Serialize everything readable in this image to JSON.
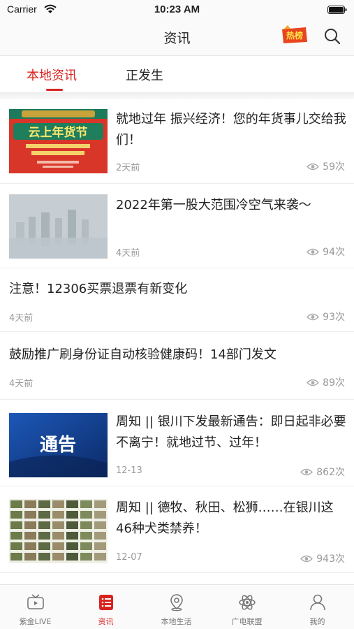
{
  "status_bar": {
    "carrier": "Carrier",
    "time": "10:23 AM"
  },
  "nav": {
    "title": "资讯",
    "hot_badge_text": "热榜"
  },
  "tabs": [
    {
      "label": "本地资讯"
    },
    {
      "label": "正发生"
    }
  ],
  "feed": [
    {
      "title": "就地过年 振兴经济！您的年货事儿交给我们！",
      "time": "2天前",
      "views": "59次",
      "thumb_text": "云上年货节"
    },
    {
      "title": "2022年第一股大范围冷空气来袭～",
      "time": "4天前",
      "views": "94次"
    },
    {
      "title": "注意！12306买票退票有新变化",
      "time": "4天前",
      "views": "93次"
    },
    {
      "title": "鼓励推广刷身份证自动核验健康码！14部门发文",
      "time": "4天前",
      "views": "89次"
    },
    {
      "title": "周知 || 银川下发最新通告：即日起非必要不离宁！就地过节、过年！",
      "time": "12-13",
      "views": "862次",
      "thumb_text": "通告"
    },
    {
      "title": "周知 || 德牧、秋田、松狮……在银川这46种犬类禁养！",
      "time": "12-07",
      "views": "943次"
    }
  ],
  "tabbar": [
    {
      "label": "紫金LIVE",
      "icon": "tv-icon"
    },
    {
      "label": "资讯",
      "icon": "news-icon"
    },
    {
      "label": "本地生活",
      "icon": "location-icon"
    },
    {
      "label": "广电联盟",
      "icon": "atom-icon"
    },
    {
      "label": "我的",
      "icon": "user-icon"
    }
  ],
  "colors": {
    "accent": "#d8231f",
    "text": "#222222",
    "muted": "#999999"
  }
}
